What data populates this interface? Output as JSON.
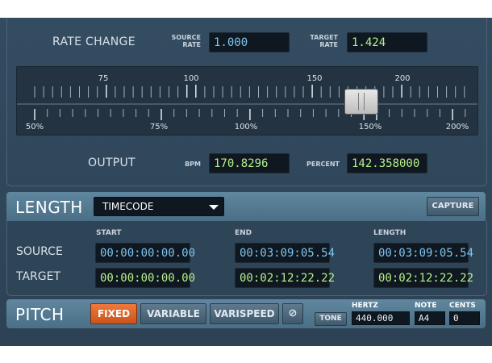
{
  "rate": {
    "title": "RATE CHANGE",
    "source_label_1": "SOURCE",
    "source_label_2": "RATE",
    "source_value": "1.000",
    "target_label_1": "TARGET",
    "target_label_2": "RATE",
    "target_value": "1.424",
    "scale_top": [
      "75",
      "100",
      "150",
      "200"
    ],
    "scale_bottom": [
      "50%",
      "75%",
      "100%",
      "150%",
      "200%"
    ],
    "slider_level_percent": 142.36,
    "output_label": "OUTPUT",
    "bpm_label": "BPM",
    "bpm_value": "170.8296",
    "percent_label": "PERCENT",
    "percent_value": "142.358000"
  },
  "length": {
    "title": "LENGTH",
    "mode": "TIMECODE",
    "capture_label": "CAPTURE",
    "columns": [
      "START",
      "END",
      "LENGTH"
    ],
    "rows": [
      {
        "label": "SOURCE",
        "values": [
          "00:00:00:00.00",
          "00:03:09:05.54",
          "00:03:09:05.54"
        ]
      },
      {
        "label": "TARGET",
        "values": [
          "00:00:00:00.00",
          "00:02:12:22.22",
          "00:02:12:22.22"
        ]
      }
    ]
  },
  "pitch": {
    "title": "PITCH",
    "modes": [
      "FIXED",
      "VARIABLE",
      "VARISPEED"
    ],
    "active_mode": "FIXED",
    "tone_label": "TONE",
    "hertz_label": "HERTZ",
    "hertz_value": "440.000",
    "note_label": "NOTE",
    "note_value": "A4",
    "cents_label": "CENTS",
    "cents_value": "0"
  },
  "colors": {
    "accent_active": "#e0652a",
    "field_blue": "#7ec5f0",
    "field_green": "#b8f08a"
  }
}
